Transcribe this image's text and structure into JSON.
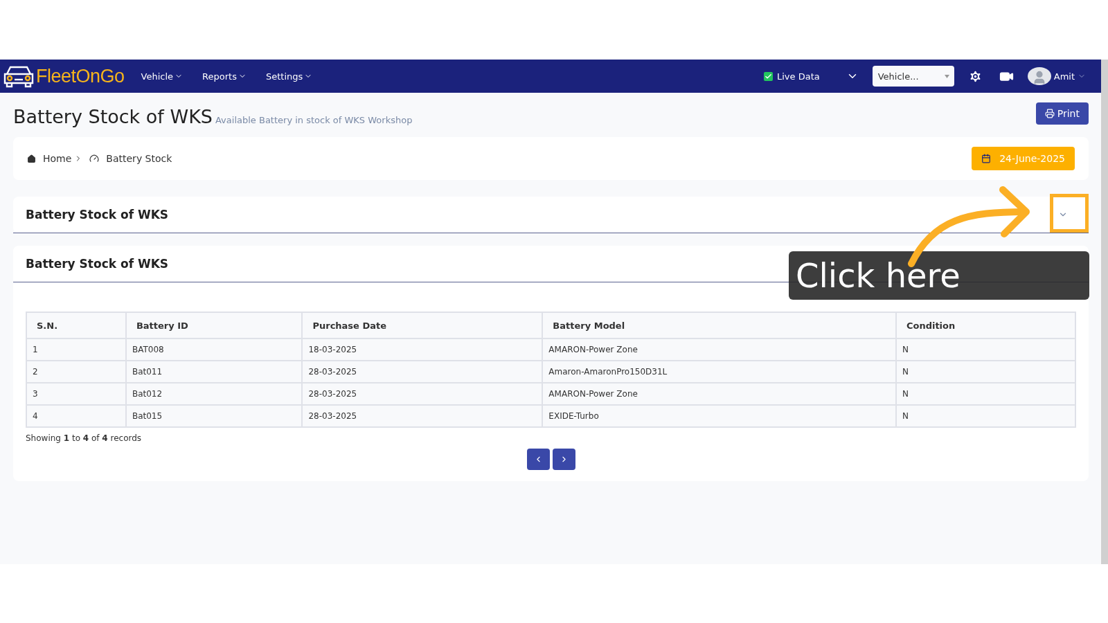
{
  "nav": {
    "logo": "FleetOnGo",
    "menus": [
      {
        "label": "Vehicle"
      },
      {
        "label": "Reports"
      },
      {
        "label": "Settings"
      }
    ],
    "live_data": {
      "label": "Live Data",
      "checked": true
    },
    "vehicle_select": {
      "value": "Vehicle..."
    },
    "user": {
      "name": "Amit"
    }
  },
  "header": {
    "title": "Battery Stock of WKS",
    "subtitle": "Available Battery in stock of WKS Workshop",
    "print_button": "Print"
  },
  "breadcrumb": {
    "items": [
      {
        "label": "Home",
        "kind": "home"
      },
      {
        "label": "Battery Stock",
        "kind": "gauge"
      }
    ],
    "date": "24-June-2025"
  },
  "filter_panel": {
    "title": "Battery Stock of WKS",
    "expanded": false
  },
  "table_panel": {
    "title": "Battery Stock of WKS",
    "table": {
      "columns": [
        "S.N.",
        "Battery ID",
        "Purchase Date",
        "Battery Model",
        "Condition"
      ],
      "rows": [
        [
          "1",
          "BAT008",
          "18-03-2025",
          "AMARON-Power Zone",
          "N"
        ],
        [
          "2",
          "Bat011",
          "28-03-2025",
          "Amaron-AmaronPro150D31L",
          "N"
        ],
        [
          "3",
          "Bat012",
          "28-03-2025",
          "AMARON-Power Zone",
          "N"
        ],
        [
          "4",
          "Bat015",
          "28-03-2025",
          "EXIDE-Turbo",
          "N"
        ]
      ]
    },
    "summary": "Showing **1** to **4** of **4** records"
  },
  "callout": {
    "text": "Click here"
  }
}
